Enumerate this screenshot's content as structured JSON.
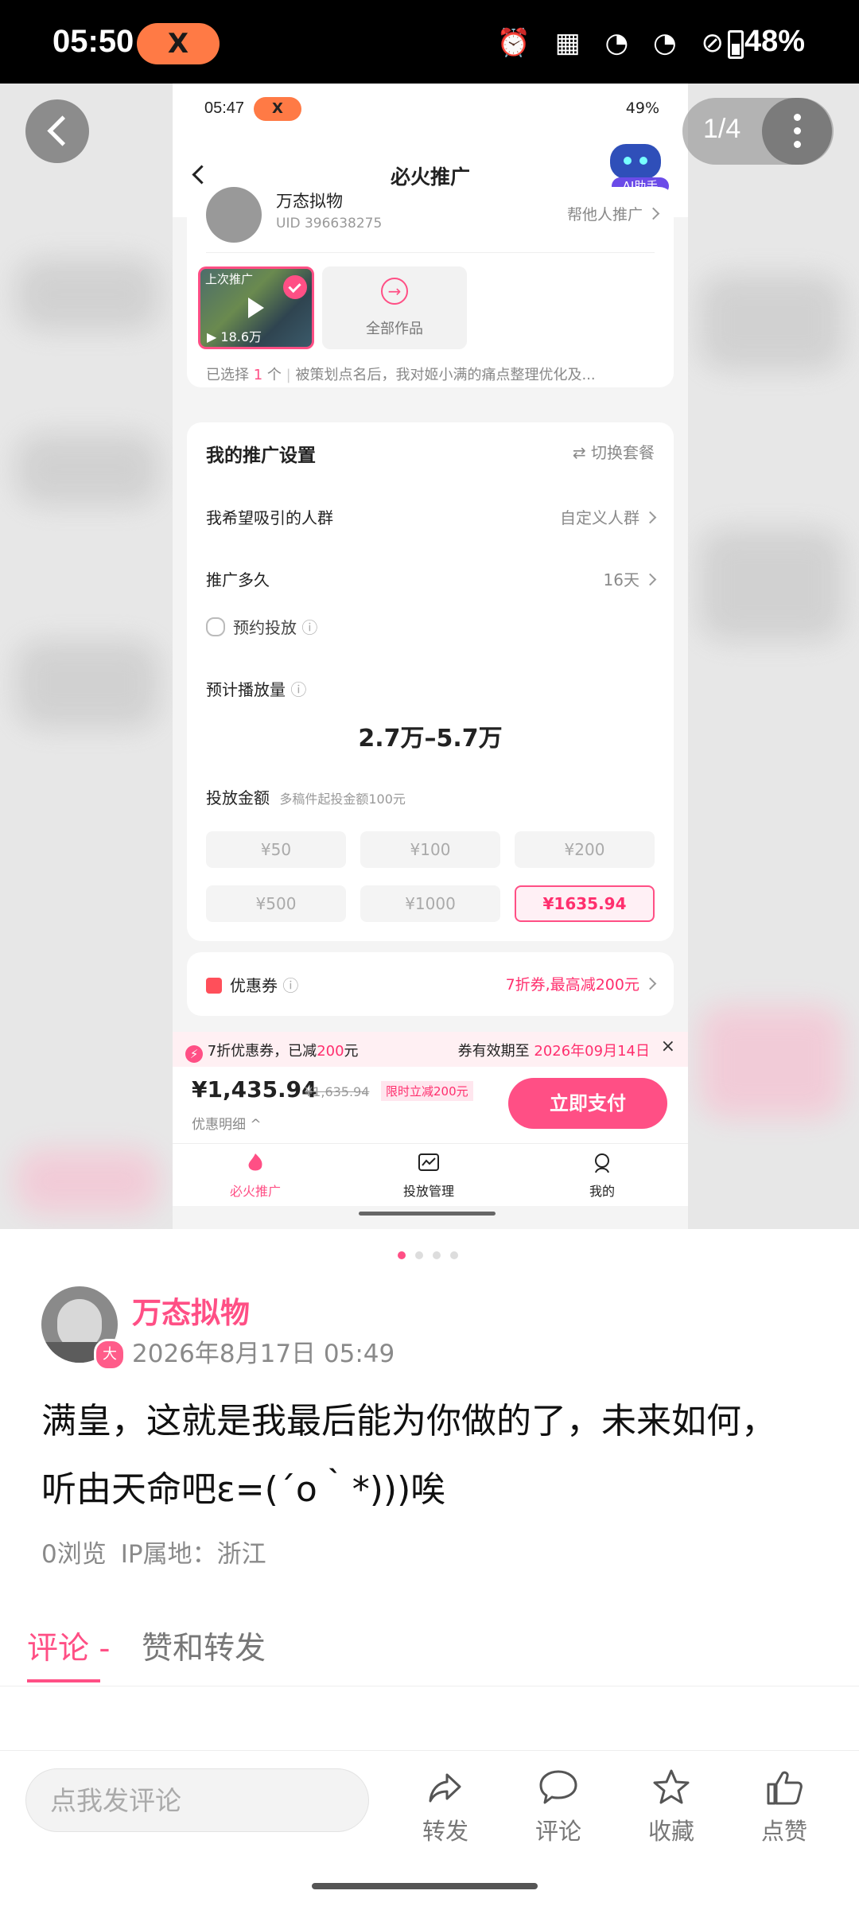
{
  "status_bar": {
    "time": "05:50",
    "app_pill": "X",
    "battery": "48%"
  },
  "viewer": {
    "pager": "1/4"
  },
  "inner": {
    "status": {
      "time": "05:47",
      "app_pill": "X",
      "battery": "49%"
    },
    "nav": {
      "title": "必火推广",
      "ai_label": "AI助手"
    },
    "account": {
      "name": "万态拟物",
      "uid": "396638275",
      "help": "帮他人推广"
    },
    "video": {
      "label": "上次推广",
      "views": "18.6万"
    },
    "all_works": "全部作品",
    "selection": {
      "prefix": "已选择",
      "count": "1",
      "suffix": "个",
      "desc": "被策划点名后，我对姬小满的痛点整理优化及..."
    },
    "settings": {
      "title": "我的推广设置",
      "switch": "切换套餐",
      "audience_label": "我希望吸引的人群",
      "audience_value": "自定义人群",
      "duration_label": "推广多久",
      "duration_value": "16天",
      "schedule": "预约投放",
      "estimate_label": "预计播放量",
      "estimate_value": "2.7万–5.7万",
      "amount_label": "投放金额",
      "amount_hint": "多稿件起投金额100元",
      "amounts": [
        "¥50",
        "¥100",
        "¥200",
        "¥500",
        "¥1000",
        "¥1635.94"
      ]
    },
    "coupon": {
      "label": "优惠券",
      "value": "7折券,最高减200元"
    },
    "coupon_bar": {
      "left_a": "7折优惠券，已减",
      "left_b": "200",
      "left_c": "元",
      "right_a": "券有效期至",
      "right_b": "2026年09月14日"
    },
    "pay": {
      "price": "¥1,435.94",
      "original": "¥1,635.94",
      "tag": "限时立减200元",
      "detail": "优惠明细",
      "button": "立即支付"
    },
    "tabbar": [
      "必火推广",
      "投放管理",
      "我的"
    ]
  },
  "post": {
    "author": "万态拟物",
    "badge": "大",
    "date": "2026年8月17日 05:49",
    "content_line1": "满皇，这就是我最后能为你做的了，未来如何，",
    "content_line2": "听由天命吧ε=(´ο｀*)))唉",
    "views": "0浏览",
    "ip": "IP属地：浙江",
    "tab_comments": "评论 -",
    "tab_likes": "赞和转发"
  },
  "bottom_bar": {
    "comment_placeholder": "点我发评论",
    "actions": [
      "转发",
      "评论",
      "收藏",
      "点赞"
    ]
  },
  "colors": {
    "accent": "#ff4f85",
    "status_bg": "#000000",
    "pill": "#ff7a45"
  }
}
